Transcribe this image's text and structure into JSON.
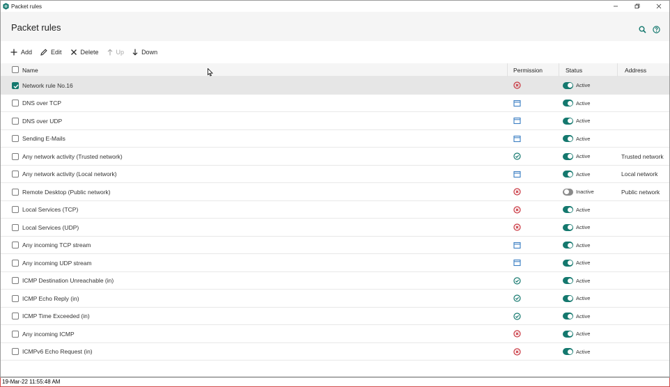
{
  "window": {
    "title": "Packet rules"
  },
  "header": {
    "title": "Packet rules",
    "search_icon": "search-icon",
    "help_icon": "help-icon"
  },
  "toolbar": {
    "add_label": "Add",
    "edit_label": "Edit",
    "delete_label": "Delete",
    "up_label": "Up",
    "down_label": "Down"
  },
  "table": {
    "columns": {
      "name": "Name",
      "permission": "Permission",
      "status": "Status",
      "address": "Address"
    },
    "rows": [
      {
        "name": "Network rule No.16",
        "permission": "block",
        "status": "Active",
        "address": "",
        "checked": true,
        "selected": true
      },
      {
        "name": "DNS over TCP",
        "permission": "app",
        "status": "Active",
        "address": ""
      },
      {
        "name": "DNS over UDP",
        "permission": "app",
        "status": "Active",
        "address": ""
      },
      {
        "name": "Sending E-Mails",
        "permission": "app",
        "status": "Active",
        "address": ""
      },
      {
        "name": "Any network activity (Trusted network)",
        "permission": "allow",
        "status": "Active",
        "address": "Trusted network"
      },
      {
        "name": "Any network activity (Local network)",
        "permission": "app",
        "status": "Active",
        "address": "Local network"
      },
      {
        "name": "Remote Desktop (Public network)",
        "permission": "block",
        "status": "Inactive",
        "address": "Public network"
      },
      {
        "name": "Local Services (TCP)",
        "permission": "block",
        "status": "Active",
        "address": ""
      },
      {
        "name": "Local Services (UDP)",
        "permission": "block",
        "status": "Active",
        "address": ""
      },
      {
        "name": "Any incoming TCP stream",
        "permission": "app",
        "status": "Active",
        "address": ""
      },
      {
        "name": "Any incoming UDP stream",
        "permission": "app",
        "status": "Active",
        "address": ""
      },
      {
        "name": "ICMP Destination Unreachable (in)",
        "permission": "allow",
        "status": "Active",
        "address": ""
      },
      {
        "name": "ICMP Echo Reply (in)",
        "permission": "allow",
        "status": "Active",
        "address": ""
      },
      {
        "name": "ICMP Time Exceeded (in)",
        "permission": "allow",
        "status": "Active",
        "address": ""
      },
      {
        "name": "Any incoming ICMP",
        "permission": "block",
        "status": "Active",
        "address": ""
      },
      {
        "name": "ICMPv6 Echo Request (in)",
        "permission": "block",
        "status": "Active",
        "address": ""
      }
    ]
  },
  "colors": {
    "accent": "#14786e",
    "block": "#c8323c",
    "app": "#3a7ec2",
    "allow": "#14786e"
  },
  "taskbar": {
    "clock": "19-Mar-22 11:55:48 AM"
  }
}
